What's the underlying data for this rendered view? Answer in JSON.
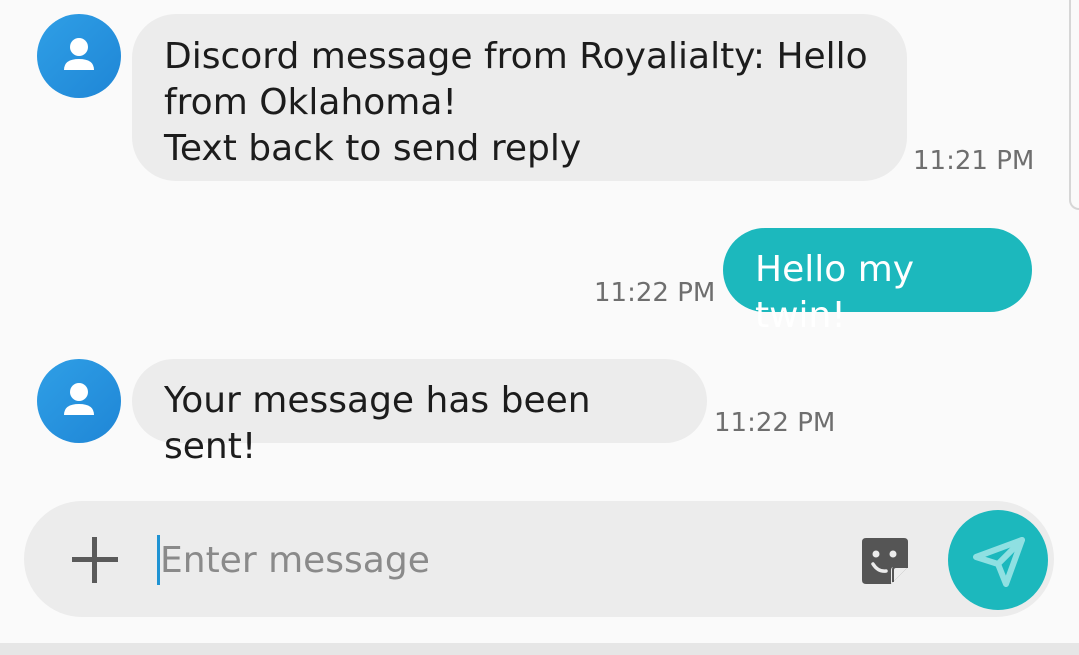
{
  "conversation": {
    "messages": [
      {
        "direction": "incoming",
        "text": "Discord message from Royalialty: Hello\nfrom Oklahoma!\nText back to send reply",
        "time": "11:21 PM"
      },
      {
        "direction": "outgoing",
        "text": "Hello my twin!",
        "time": "11:22 PM"
      },
      {
        "direction": "incoming",
        "text": "Your message has been sent!",
        "time": "11:22 PM"
      }
    ]
  },
  "composer": {
    "placeholder": "Enter message",
    "value": ""
  },
  "icons": {
    "avatar": "person-icon",
    "attach": "plus-icon",
    "sticker": "sticker-icon",
    "send": "send-icon"
  },
  "colors": {
    "accent": "#1cb8bd",
    "incoming_bubble": "#ececec",
    "avatar": "#2196e0",
    "cursor": "#1f93d3"
  }
}
